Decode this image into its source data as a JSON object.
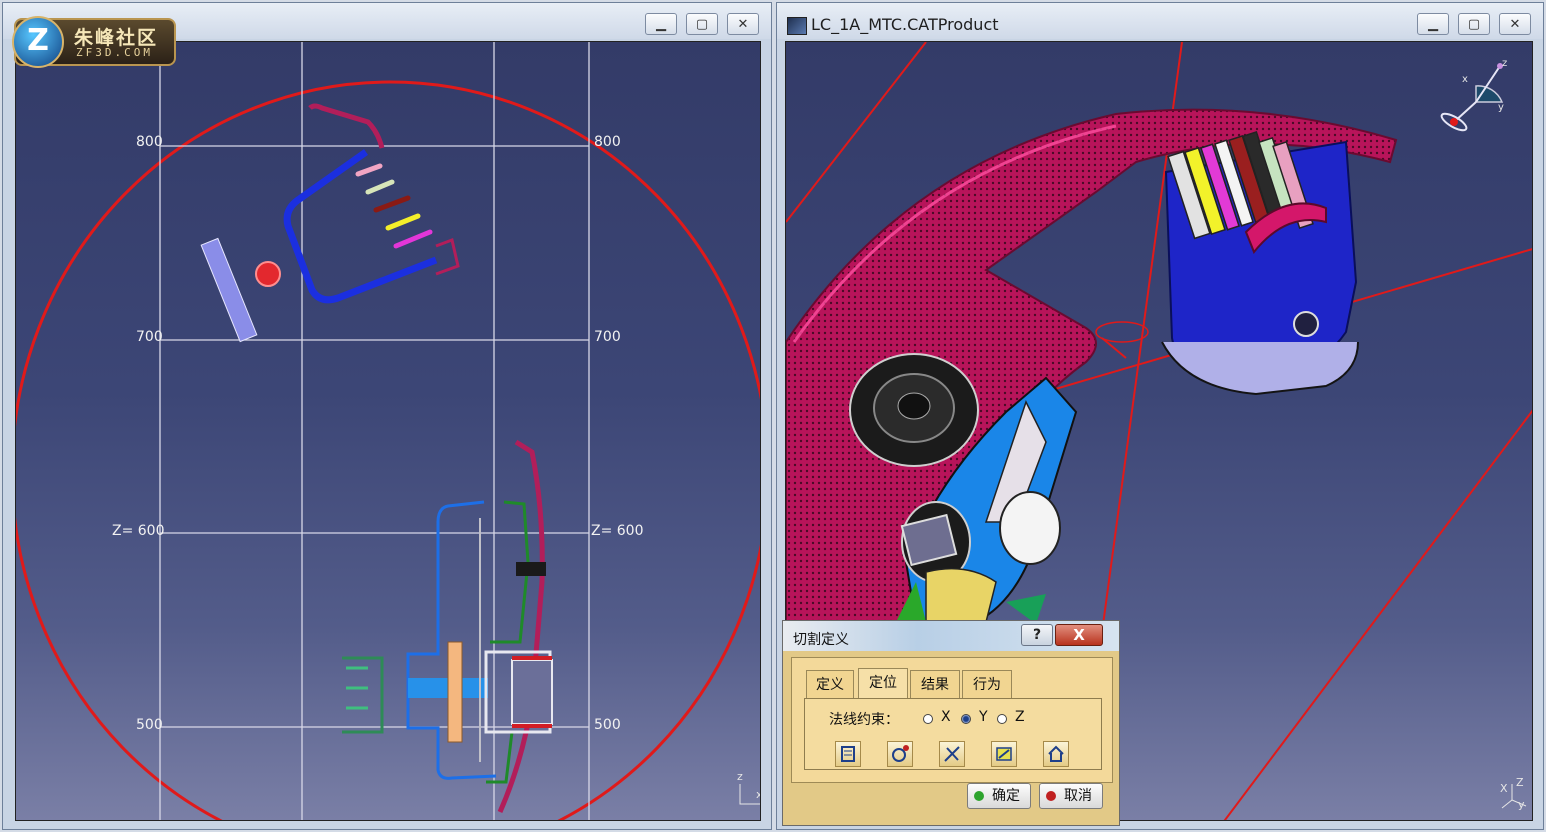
{
  "logo": {
    "cn": "朱峰社区",
    "en": "ZF3D.COM",
    "z": "Z"
  },
  "left_window": {
    "buttons": {
      "minimize": "▁",
      "maximize": "▢",
      "close": "✕"
    },
    "grid_labels": {
      "l800": "800",
      "r800": "800",
      "l700": "700",
      "r700": "700",
      "l600": "Z= 600",
      "r600": "Z= 600",
      "l500": "500",
      "r500": "500"
    },
    "axis": {
      "z": "z",
      "x": "x"
    }
  },
  "right_window": {
    "title": "LC_1A_MTC.CATProduct",
    "buttons": {
      "minimize": "▁",
      "maximize": "▢",
      "close": "✕"
    },
    "axis": {
      "z": "Z",
      "x": "X",
      "y": "y"
    }
  },
  "dialog": {
    "title": "切割定义",
    "help": "?",
    "close": "X",
    "tabs": [
      "定义",
      "定位",
      "结果",
      "行为"
    ],
    "active_tab": 1,
    "normal_constraint_label": "法线约束：",
    "radio": {
      "x": "X",
      "y": "Y",
      "z": "Z",
      "selected": "Y"
    },
    "tool_icons": [
      "edit-position-icon",
      "snap-point-icon",
      "reverse-normal-icon",
      "reset-icon",
      "home-icon"
    ],
    "ok": "确定",
    "cancel": "取消",
    "colors": {
      "ok_dot": "#2ea42e",
      "cancel_dot": "#c02020"
    }
  }
}
